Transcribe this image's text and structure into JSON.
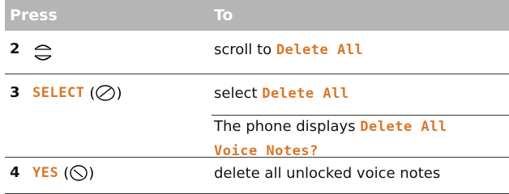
{
  "header": {
    "press": "Press",
    "to": "To"
  },
  "rows": [
    {
      "step": "2",
      "key_label": "",
      "key_icon": "scroll-key-icon",
      "action_prefix": "scroll to ",
      "action_target": "Delete All"
    },
    {
      "step": "3",
      "key_label": "SELECT",
      "key_icon": "select-key-icon",
      "action_prefix": "select ",
      "action_target": "Delete All",
      "note_prefix": "The phone displays ",
      "note_target_1": "Delete All",
      "note_target_2": "Voice Notes?"
    },
    {
      "step": "4",
      "key_label": "YES",
      "key_icon": "yes-key-icon",
      "action_prefix": "delete all unlocked voice notes",
      "action_target": ""
    }
  ]
}
